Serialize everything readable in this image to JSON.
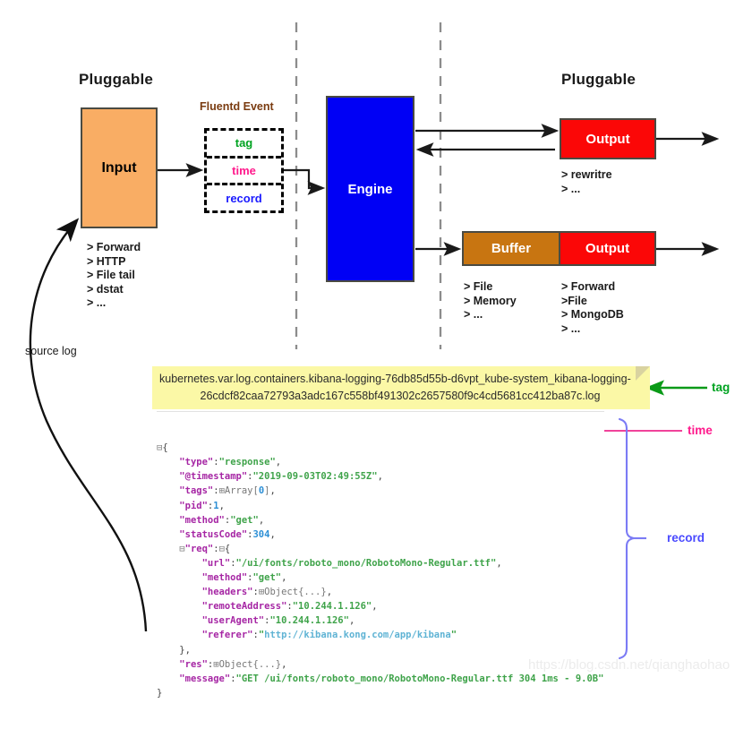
{
  "sections": {
    "left_pluggable": "Pluggable",
    "right_pluggable": "Pluggable",
    "fluentd_event_title": "Fluentd Event"
  },
  "boxes": {
    "input": "Input",
    "engine": "Engine",
    "output_top": "Output",
    "buffer": "Buffer",
    "output_bottom": "Output"
  },
  "event": {
    "tag": "tag",
    "time": "time",
    "record": "record"
  },
  "bullets": {
    "input": "> Forward\n> HTTP\n> File tail\n> dstat\n> ...",
    "output_top": "> rewritre\n> ...",
    "buffer": "> File\n> Memory\n> ...",
    "output_bottom": "> Forward\n>File\n> MongoDB\n> ..."
  },
  "annotations": {
    "source_log": "source log",
    "tag_label": "tag",
    "time_label": "time",
    "record_label": "record"
  },
  "tag_banner": {
    "line1": "kubernetes.var.log.containers.kibana-logging-76db85d55b-d6vpt_kube-system_kibana-logging-",
    "line2": "26cdcf82caa72793a3adc167c558bf491302c2657580f9c4cd5681cc412ba87c.log"
  },
  "code": {
    "lines": [
      {
        "indent": 0,
        "fold": "minus",
        "text": "{"
      },
      {
        "indent": 1,
        "key": "\"type\"",
        "value": "\"response\"",
        "vtype": "string",
        "comma": true
      },
      {
        "indent": 1,
        "key": "\"@timestamp\"",
        "value": "\"2019-09-03T02:49:55Z\"",
        "vtype": "string",
        "comma": true
      },
      {
        "indent": 1,
        "key": "\"tags\"",
        "value": "Array[0]",
        "vtype": "array",
        "fold": "plus",
        "comma": true
      },
      {
        "indent": 1,
        "key": "\"pid\"",
        "value": "1",
        "vtype": "number",
        "comma": true
      },
      {
        "indent": 1,
        "key": "\"method\"",
        "value": "\"get\"",
        "vtype": "string",
        "comma": true
      },
      {
        "indent": 1,
        "key": "\"statusCode\"",
        "value": "304",
        "vtype": "number",
        "comma": true
      },
      {
        "indent": 1,
        "key": "\"req\"",
        "value": "{",
        "vtype": "open",
        "fold": "minus"
      },
      {
        "indent": 2,
        "key": "\"url\"",
        "value": "\"/ui/fonts/roboto_mono/RobotoMono-Regular.ttf\"",
        "vtype": "string",
        "comma": true
      },
      {
        "indent": 2,
        "key": "\"method\"",
        "value": "\"get\"",
        "vtype": "string",
        "comma": true
      },
      {
        "indent": 2,
        "key": "\"headers\"",
        "value": "Object{...}",
        "vtype": "object",
        "fold": "plus",
        "comma": true
      },
      {
        "indent": 2,
        "key": "\"remoteAddress\"",
        "value": "\"10.244.1.126\"",
        "vtype": "string",
        "comma": true
      },
      {
        "indent": 2,
        "key": "\"userAgent\"",
        "value": "\"10.244.1.126\"",
        "vtype": "string",
        "comma": true
      },
      {
        "indent": 2,
        "key": "\"referer\"",
        "value": "\"http://kibana.kong.com/app/kibana\"",
        "vtype": "url"
      },
      {
        "indent": 1,
        "text": "},"
      },
      {
        "indent": 1,
        "key": "\"res\"",
        "value": "Object{...}",
        "vtype": "object",
        "fold": "plus",
        "comma": true
      },
      {
        "indent": 1,
        "key": "\"message\"",
        "value": "\"GET /ui/fonts/roboto_mono/RobotoMono-Regular.ttf 304 1ms - 9.0B\"",
        "vtype": "string"
      },
      {
        "indent": 0,
        "text": "}"
      }
    ]
  },
  "watermark": "https://blog.csdn.net/qianghaohao",
  "colors": {
    "input_fill": "#f9ad64",
    "engine_fill": "#0000f5",
    "output_fill": "#fb0707",
    "buffer_fill": "#c87511",
    "banner_fill": "#fbf8a6",
    "tag_green": "#00a321",
    "time_pink": "#ff1a8c",
    "record_purple": "#4a4aff"
  }
}
